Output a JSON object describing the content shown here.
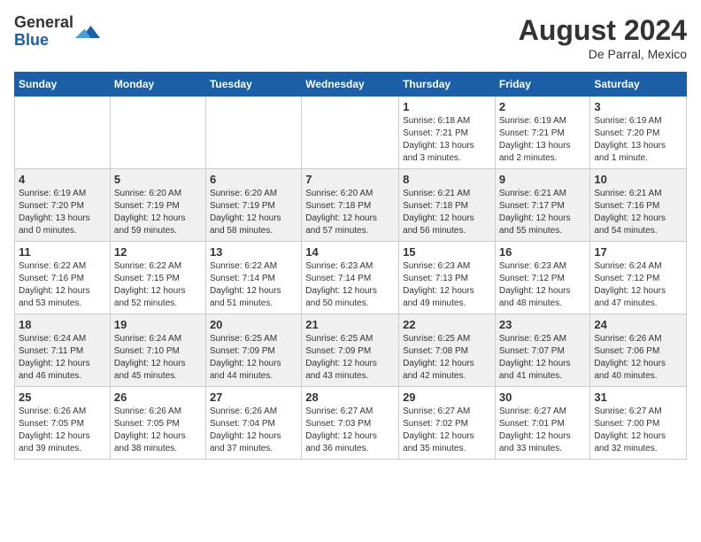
{
  "header": {
    "logo_general": "General",
    "logo_blue": "Blue",
    "month_year": "August 2024",
    "location": "De Parral, Mexico"
  },
  "weekdays": [
    "Sunday",
    "Monday",
    "Tuesday",
    "Wednesday",
    "Thursday",
    "Friday",
    "Saturday"
  ],
  "weeks": [
    [
      {
        "day": "",
        "info": ""
      },
      {
        "day": "",
        "info": ""
      },
      {
        "day": "",
        "info": ""
      },
      {
        "day": "",
        "info": ""
      },
      {
        "day": "1",
        "info": "Sunrise: 6:18 AM\nSunset: 7:21 PM\nDaylight: 13 hours\nand 3 minutes."
      },
      {
        "day": "2",
        "info": "Sunrise: 6:19 AM\nSunset: 7:21 PM\nDaylight: 13 hours\nand 2 minutes."
      },
      {
        "day": "3",
        "info": "Sunrise: 6:19 AM\nSunset: 7:20 PM\nDaylight: 13 hours\nand 1 minute."
      }
    ],
    [
      {
        "day": "4",
        "info": "Sunrise: 6:19 AM\nSunset: 7:20 PM\nDaylight: 13 hours\nand 0 minutes."
      },
      {
        "day": "5",
        "info": "Sunrise: 6:20 AM\nSunset: 7:19 PM\nDaylight: 12 hours\nand 59 minutes."
      },
      {
        "day": "6",
        "info": "Sunrise: 6:20 AM\nSunset: 7:19 PM\nDaylight: 12 hours\nand 58 minutes."
      },
      {
        "day": "7",
        "info": "Sunrise: 6:20 AM\nSunset: 7:18 PM\nDaylight: 12 hours\nand 57 minutes."
      },
      {
        "day": "8",
        "info": "Sunrise: 6:21 AM\nSunset: 7:18 PM\nDaylight: 12 hours\nand 56 minutes."
      },
      {
        "day": "9",
        "info": "Sunrise: 6:21 AM\nSunset: 7:17 PM\nDaylight: 12 hours\nand 55 minutes."
      },
      {
        "day": "10",
        "info": "Sunrise: 6:21 AM\nSunset: 7:16 PM\nDaylight: 12 hours\nand 54 minutes."
      }
    ],
    [
      {
        "day": "11",
        "info": "Sunrise: 6:22 AM\nSunset: 7:16 PM\nDaylight: 12 hours\nand 53 minutes."
      },
      {
        "day": "12",
        "info": "Sunrise: 6:22 AM\nSunset: 7:15 PM\nDaylight: 12 hours\nand 52 minutes."
      },
      {
        "day": "13",
        "info": "Sunrise: 6:22 AM\nSunset: 7:14 PM\nDaylight: 12 hours\nand 51 minutes."
      },
      {
        "day": "14",
        "info": "Sunrise: 6:23 AM\nSunset: 7:14 PM\nDaylight: 12 hours\nand 50 minutes."
      },
      {
        "day": "15",
        "info": "Sunrise: 6:23 AM\nSunset: 7:13 PM\nDaylight: 12 hours\nand 49 minutes."
      },
      {
        "day": "16",
        "info": "Sunrise: 6:23 AM\nSunset: 7:12 PM\nDaylight: 12 hours\nand 48 minutes."
      },
      {
        "day": "17",
        "info": "Sunrise: 6:24 AM\nSunset: 7:12 PM\nDaylight: 12 hours\nand 47 minutes."
      }
    ],
    [
      {
        "day": "18",
        "info": "Sunrise: 6:24 AM\nSunset: 7:11 PM\nDaylight: 12 hours\nand 46 minutes."
      },
      {
        "day": "19",
        "info": "Sunrise: 6:24 AM\nSunset: 7:10 PM\nDaylight: 12 hours\nand 45 minutes."
      },
      {
        "day": "20",
        "info": "Sunrise: 6:25 AM\nSunset: 7:09 PM\nDaylight: 12 hours\nand 44 minutes."
      },
      {
        "day": "21",
        "info": "Sunrise: 6:25 AM\nSunset: 7:09 PM\nDaylight: 12 hours\nand 43 minutes."
      },
      {
        "day": "22",
        "info": "Sunrise: 6:25 AM\nSunset: 7:08 PM\nDaylight: 12 hours\nand 42 minutes."
      },
      {
        "day": "23",
        "info": "Sunrise: 6:25 AM\nSunset: 7:07 PM\nDaylight: 12 hours\nand 41 minutes."
      },
      {
        "day": "24",
        "info": "Sunrise: 6:26 AM\nSunset: 7:06 PM\nDaylight: 12 hours\nand 40 minutes."
      }
    ],
    [
      {
        "day": "25",
        "info": "Sunrise: 6:26 AM\nSunset: 7:05 PM\nDaylight: 12 hours\nand 39 minutes."
      },
      {
        "day": "26",
        "info": "Sunrise: 6:26 AM\nSunset: 7:05 PM\nDaylight: 12 hours\nand 38 minutes."
      },
      {
        "day": "27",
        "info": "Sunrise: 6:26 AM\nSunset: 7:04 PM\nDaylight: 12 hours\nand 37 minutes."
      },
      {
        "day": "28",
        "info": "Sunrise: 6:27 AM\nSunset: 7:03 PM\nDaylight: 12 hours\nand 36 minutes."
      },
      {
        "day": "29",
        "info": "Sunrise: 6:27 AM\nSunset: 7:02 PM\nDaylight: 12 hours\nand 35 minutes."
      },
      {
        "day": "30",
        "info": "Sunrise: 6:27 AM\nSunset: 7:01 PM\nDaylight: 12 hours\nand 33 minutes."
      },
      {
        "day": "31",
        "info": "Sunrise: 6:27 AM\nSunset: 7:00 PM\nDaylight: 12 hours\nand 32 minutes."
      }
    ]
  ]
}
